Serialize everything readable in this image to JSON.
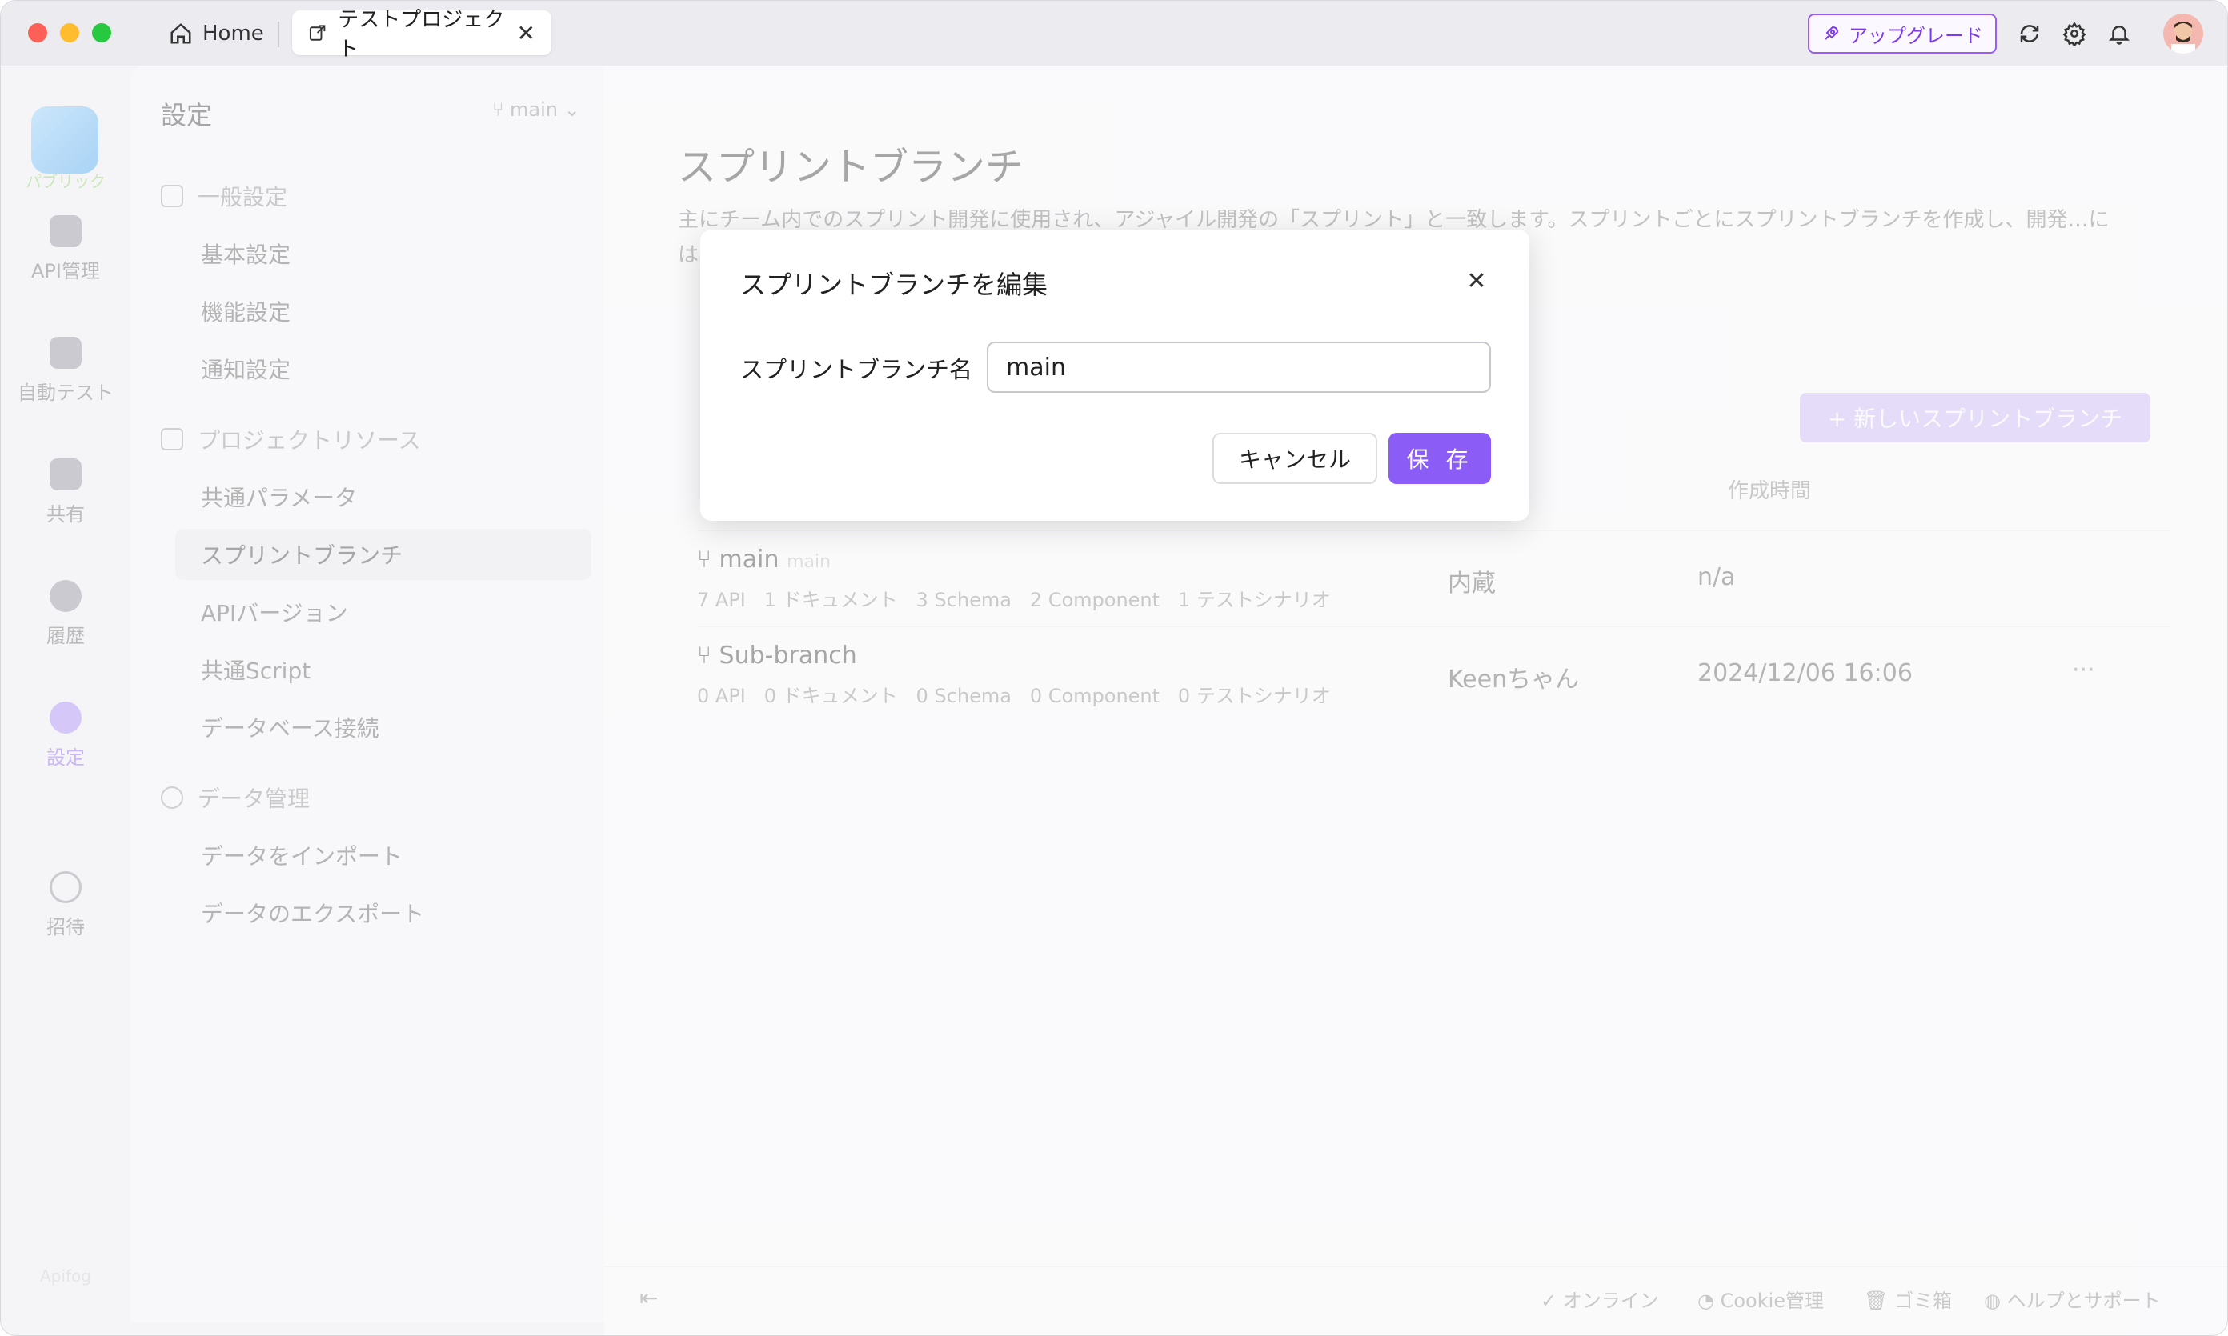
{
  "titlebar": {
    "home_tab": "Home",
    "project_tab": "テストプロジェクト",
    "upgrade_label": "アップグレード"
  },
  "leftnav": {
    "logo_label": "パブリック",
    "items": [
      {
        "label": "API管理",
        "icon": "api-icon"
      },
      {
        "label": "自動テスト",
        "icon": "test-icon"
      },
      {
        "label": "共有",
        "icon": "book-icon"
      },
      {
        "label": "履歴",
        "icon": "clock-icon"
      },
      {
        "label": "設定",
        "icon": "settings-icon"
      },
      {
        "label": "招待",
        "icon": "invite-icon"
      }
    ],
    "brand": "Apifog"
  },
  "settings": {
    "title": "設定",
    "branch": "main",
    "sections": [
      {
        "label": "一般設定",
        "items": [
          "基本設定",
          "機能設定",
          "通知設定"
        ]
      },
      {
        "label": "プロジェクトリソース",
        "items": [
          "共通パラメータ",
          "スプリントブランチ",
          "APIバージョン",
          "共通Script",
          "データベース接続"
        ]
      },
      {
        "label": "データ管理",
        "items": [
          "データをインポート",
          "データのエクスポート"
        ]
      }
    ]
  },
  "main": {
    "title": "スプリントブランチ",
    "description": "主にチーム内でのスプリント開発に使用され、アジャイル開発の「スプリント」と一致します。スプリントごとにスプリントブランチを作成し、開発…には、現在のスプリントの「新規および変更されたAPI」のみが…",
    "new_button": "+ 新しいスプリントブランチ",
    "columns": [
      "者",
      "作成時間"
    ],
    "rows": [
      {
        "name": "main",
        "tag": "main",
        "stats": "7 API   1 ドキュメント   3 Schema   2 Component   1 テストシナリオ",
        "creator": "内蔵",
        "time": "n/a"
      },
      {
        "name": "Sub-branch",
        "tag": "",
        "stats": "0 API   0 ドキュメント   0 Schema   0 Component   0 テストシナリオ",
        "creator": "Keenちゃん",
        "time": "2024/12/06 16:06"
      }
    ]
  },
  "footer": {
    "online": "オンライン",
    "cookie": "Cookie管理",
    "trash": "ゴミ箱",
    "help": "ヘルプとサポート"
  },
  "modal": {
    "title": "スプリントブランチを編集",
    "field_label": "スプリントブランチ名",
    "field_value": "main",
    "cancel_label": "キャンセル",
    "save_label": "保 存"
  },
  "colors": {
    "accent": "#8b5cf6",
    "upgrade_border": "#9b5cf6"
  }
}
